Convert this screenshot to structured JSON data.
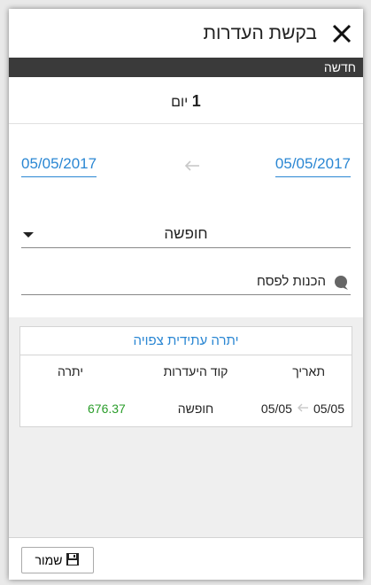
{
  "header": {
    "title": "בקשת העדרות"
  },
  "status": {
    "label": "חדשה"
  },
  "duration": {
    "number": "1",
    "unit": "יום"
  },
  "dates": {
    "from": "05/05/2017",
    "to": "05/05/2017"
  },
  "absence_type": {
    "value": "חופשה"
  },
  "note": {
    "text": "הכנות לפסח"
  },
  "balance_card": {
    "title": "יתרה עתידית צפויה",
    "columns": {
      "date": "תאריך",
      "code": "קוד היעדרות",
      "balance": "יתרה"
    },
    "rows": [
      {
        "date_from": "05/05",
        "date_to": "05/05",
        "code": "חופשה",
        "balance": "676.37"
      }
    ]
  },
  "footer": {
    "save_label": "שמור"
  },
  "colors": {
    "accent": "#2b87d3",
    "status_bar": "#3a3a3a",
    "positive": "#2a9d2a"
  }
}
